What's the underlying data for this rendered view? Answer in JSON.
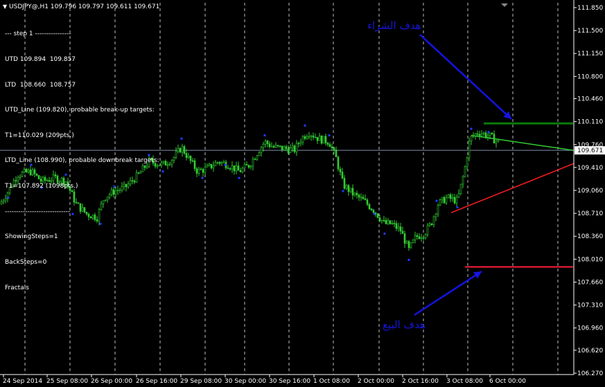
{
  "header": {
    "symbol_line": "USDJPY@,H1  109.796 109.797 109.611 109.671"
  },
  "info_panel": {
    "lines": [
      "--- step 1 ----------------",
      "UTD 109.894  109.857",
      "LTD  108.660  108.757",
      "UTD_Line (109.820), probable break-up targets:",
      "T1=110.029 (209pts.)",
      "LTD_Line (108.990), probable downbreak targets:",
      "T1=107.892 (1098pts.)",
      "-----------------------------",
      "ShowingSteps=1",
      "BackSteps=0",
      "Fractals"
    ]
  },
  "annotations": {
    "buy_target": "هدف الشراء",
    "sell_target": "هدف البيع"
  },
  "colors": {
    "background": "#000000",
    "candles": "#32cd32",
    "fractal": "#1e3cff",
    "grid": "#ffffff",
    "buy_line": "#0a7a0a",
    "sell_line": "#ff1e3c",
    "utd_line": "#32cd32",
    "ltd_line": "#ff1e1e",
    "arrow": "#1414e6",
    "current_price_line": "#8090b0"
  },
  "chart_data": {
    "type": "candlestick",
    "symbol": "USDJPY@",
    "timeframe": "H1",
    "current_price": 109.671,
    "ylim": [
      106.27,
      111.85
    ],
    "y_ticks": [
      "111.850",
      "111.500",
      "111.150",
      "110.800",
      "110.460",
      "110.110",
      "109.760",
      "109.410",
      "109.060",
      "108.710",
      "108.360",
      "108.010",
      "107.660",
      "107.310",
      "106.960",
      "106.620",
      "106.270"
    ],
    "x_ticks": [
      "24 Sep 2014",
      "25 Sep 08:00",
      "26 Sep 00:00",
      "26 Sep 16:00",
      "29 Sep 08:00",
      "30 Sep 00:00",
      "30 Sep 16:00",
      "1 Oct 08:00",
      "2 Oct 00:00",
      "2 Oct 16:00",
      "3 Oct 08:00",
      "6 Oct 00:00"
    ],
    "close_path": [
      [
        0,
        108.85
      ],
      [
        12,
        109.05
      ],
      [
        25,
        109.3
      ],
      [
        45,
        109.35
      ],
      [
        60,
        109.2
      ],
      [
        80,
        109.25
      ],
      [
        95,
        109.2
      ],
      [
        110,
        108.85
      ],
      [
        125,
        108.7
      ],
      [
        140,
        108.65
      ],
      [
        150,
        108.95
      ],
      [
        165,
        109.05
      ],
      [
        180,
        109.1
      ],
      [
        200,
        109.3
      ],
      [
        215,
        109.5
      ],
      [
        235,
        109.45
      ],
      [
        250,
        109.55
      ],
      [
        262,
        109.72
      ],
      [
        272,
        109.55
      ],
      [
        285,
        109.35
      ],
      [
        300,
        109.4
      ],
      [
        315,
        109.5
      ],
      [
        330,
        109.45
      ],
      [
        345,
        109.35
      ],
      [
        360,
        109.45
      ],
      [
        372,
        109.65
      ],
      [
        382,
        109.8
      ],
      [
        395,
        109.72
      ],
      [
        410,
        109.7
      ],
      [
        425,
        109.68
      ],
      [
        435,
        109.85
      ],
      [
        445,
        109.95
      ],
      [
        460,
        109.85
      ],
      [
        475,
        109.8
      ],
      [
        485,
        109.55
      ],
      [
        495,
        109.15
      ],
      [
        510,
        109.0
      ],
      [
        525,
        108.9
      ],
      [
        540,
        108.75
      ],
      [
        555,
        108.55
      ],
      [
        565,
        108.55
      ],
      [
        578,
        108.45
      ],
      [
        590,
        108.15
      ],
      [
        600,
        108.35
      ],
      [
        612,
        108.4
      ],
      [
        622,
        108.55
      ],
      [
        632,
        108.85
      ],
      [
        645,
        108.95
      ],
      [
        660,
        108.9
      ],
      [
        670,
        109.35
      ],
      [
        678,
        109.85
      ],
      [
        690,
        109.95
      ],
      [
        705,
        109.9
      ],
      [
        718,
        109.8
      ]
    ],
    "fractals": [
      [
        12,
        108.95
      ],
      [
        45,
        109.45
      ],
      [
        60,
        109.1
      ],
      [
        95,
        109.3
      ],
      [
        105,
        108.7
      ],
      [
        145,
        108.55
      ],
      [
        165,
        109.12
      ],
      [
        215,
        109.6
      ],
      [
        235,
        109.35
      ],
      [
        262,
        109.85
      ],
      [
        292,
        109.25
      ],
      [
        325,
        109.45
      ],
      [
        345,
        109.25
      ],
      [
        382,
        109.9
      ],
      [
        440,
        110.05
      ],
      [
        475,
        109.9
      ],
      [
        495,
        109.05
      ],
      [
        540,
        108.7
      ],
      [
        555,
        108.4
      ],
      [
        590,
        108.0
      ],
      [
        630,
        108.9
      ],
      [
        660,
        108.8
      ],
      [
        680,
        110.0
      ],
      [
        705,
        109.95
      ]
    ],
    "levels": {
      "buy_target": 110.029,
      "sell_target": 107.892,
      "utd_line": {
        "from": [
          680,
          109.9
        ],
        "to": [
          828,
          109.67
        ]
      },
      "ltd_line": {
        "from": [
          651,
          108.72
        ],
        "to": [
          828,
          109.47
        ]
      }
    }
  }
}
